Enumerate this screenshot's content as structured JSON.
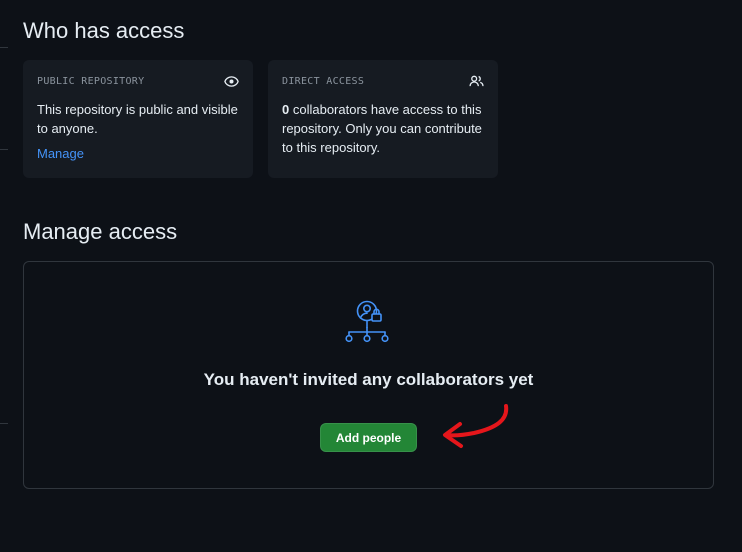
{
  "who_has_access": {
    "title": "Who has access",
    "public_card": {
      "kicker": "PUBLIC REPOSITORY",
      "text": "This repository is public and visible to anyone.",
      "link": "Manage",
      "icon": "eye-icon"
    },
    "direct_card": {
      "kicker": "DIRECT ACCESS",
      "count": "0",
      "text": " collaborators have access to this repository. Only you can contribute to this repository.",
      "icon": "people-icon"
    }
  },
  "manage_access": {
    "title": "Manage access",
    "empty_icon": "collaborators-lock-icon",
    "empty_title": "You haven't invited any collaborators yet",
    "add_button": "Add people"
  },
  "colors": {
    "background": "#0d1117",
    "card": "#161b22",
    "border": "#30363d",
    "link": "#4493f8",
    "primary_button": "#238636",
    "annotation": "#e5161b"
  }
}
